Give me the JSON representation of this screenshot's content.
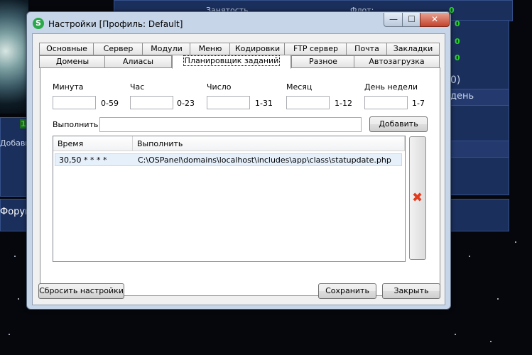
{
  "background": {
    "labels": {
      "employment": "Занятость",
      "fleet": "Флот:",
      "add": "Добави",
      "forum": "Форум",
      "day": "день",
      "paren": "0)"
    },
    "counters": [
      "0",
      "0",
      "0",
      "0",
      "1"
    ]
  },
  "window": {
    "icon_letter": "S",
    "title": "Настройки [Профиль: Default]",
    "controls": {
      "minimize": "—",
      "maximize": "☐",
      "close": "✕"
    }
  },
  "tabs": {
    "row1": [
      "Основные",
      "Сервер",
      "Модули",
      "Меню",
      "Кодировки",
      "FTP сервер",
      "Почта",
      "Закладки"
    ],
    "row2": [
      "Домены",
      "Алиасы",
      "Планировщик заданий",
      "Разное",
      "Автозагрузка"
    ],
    "active": "Планировщик заданий"
  },
  "scheduler": {
    "fields": [
      {
        "label": "Минута",
        "value": "",
        "range": "0-59"
      },
      {
        "label": "Час",
        "value": "",
        "range": "0-23"
      },
      {
        "label": "Число",
        "value": "",
        "range": "1-31"
      },
      {
        "label": "Месяц",
        "value": "",
        "range": "1-12"
      },
      {
        "label": "День недели",
        "value": "",
        "range": "1-7"
      }
    ],
    "execute_label": "Выполнить",
    "execute_value": "",
    "add_button": "Добавить",
    "table": {
      "columns": [
        "Время",
        "Выполнить"
      ],
      "rows": [
        {
          "time": "30,50 * * * *",
          "command": "C:\\OSPanel\\domains\\localhost\\includes\\app\\class\\statupdate.php"
        }
      ]
    },
    "delete_icon": "red-x-icon"
  },
  "footer": {
    "reset_button": "Сбросить настройки",
    "save_button": "Сохранить",
    "close_button": "Закрыть"
  },
  "colors": {
    "accent_close": "#c4432c",
    "delete_x": "#e23c1e",
    "counter_green": "#28d428"
  }
}
